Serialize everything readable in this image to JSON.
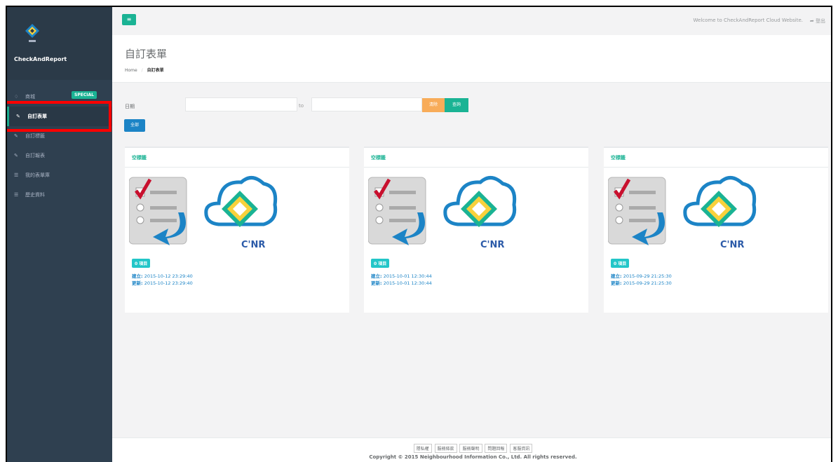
{
  "sidebar": {
    "brand": "CheckAndReport",
    "items": [
      {
        "label": "商城",
        "icon": "diamond-icon",
        "badge": "SPECIAL"
      },
      {
        "label": "自訂表單",
        "icon": "edit-icon"
      },
      {
        "label": "自訂標籤",
        "icon": "edit-icon"
      },
      {
        "label": "自訂報表",
        "icon": "edit-icon"
      },
      {
        "label": "我的表單庫",
        "icon": "list-icon"
      },
      {
        "label": "歷史資料",
        "icon": "list-icon"
      }
    ]
  },
  "topbar": {
    "menu_icon": "≡",
    "welcome": "Welcome to CheckAndReport Cloud Website.",
    "logout": "登出"
  },
  "header": {
    "title": "自訂表單",
    "breadcrumb_home": "Home",
    "breadcrumb_sep": "/",
    "breadcrumb_current": "自訂表單"
  },
  "filter": {
    "date_label": "日期",
    "to_label": "to",
    "start_value": "",
    "end_value": "",
    "clear_label": "清除",
    "search_label": "查詢",
    "all_label": "全部"
  },
  "cards": [
    {
      "title": "空標籤",
      "count": "0 項目",
      "created_label": "建立:",
      "created": "2015-10-12 23:29:40",
      "updated_label": "更新:",
      "updated": "2015-10-12 23:29:40"
    },
    {
      "title": "空標籤",
      "count": "0 項目",
      "created_label": "建立:",
      "created": "2015-10-01 12:30:44",
      "updated_label": "更新:",
      "updated": "2015-10-01 12:30:44"
    },
    {
      "title": "空標籤",
      "count": "0 項目",
      "created_label": "建立:",
      "created": "2015-09-29 21:25:30",
      "updated_label": "更新:",
      "updated": "2015-09-29 21:25:30"
    }
  ],
  "card_image_text": "C'NR",
  "footer": {
    "links": [
      "隱私權",
      "服務條款",
      "服務聲明",
      "問題回報",
      "客服資訊"
    ],
    "copyright": "Copyright © 2015 Neighbourhood Information Co., Ltd. All rights reserved."
  },
  "colors": {
    "sidebar": "#2f4050",
    "accent": "#1ab394",
    "orange": "#f8ac59",
    "blue": "#1c84c6",
    "highlight": "#ff0000"
  }
}
